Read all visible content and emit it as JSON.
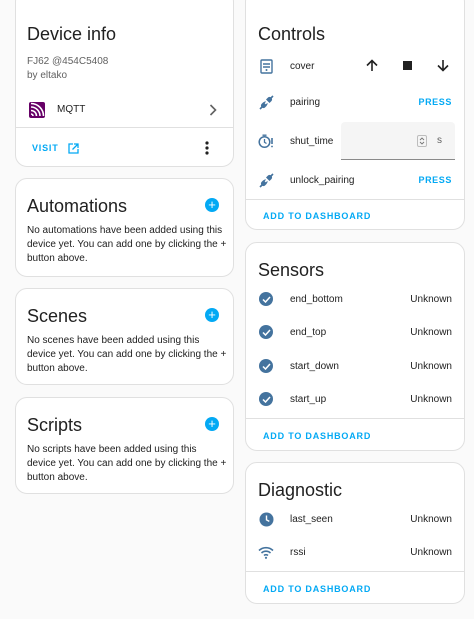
{
  "device_info": {
    "title": "Device info",
    "model": "FJ62 @454C5408",
    "manufacturer": "by eltako",
    "integration": "MQTT",
    "visit_label": "VISIT"
  },
  "automations": {
    "title": "Automations",
    "description": "No automations have been added using this device yet. You can add one by clicking the + button above."
  },
  "scenes": {
    "title": "Scenes",
    "description": "No scenes have been added using this device yet. You can add one by clicking the + button above."
  },
  "scripts": {
    "title": "Scripts",
    "description": "No scripts have been added using this device yet. You can add one by clicking the + button above."
  },
  "controls": {
    "title": "Controls",
    "entities": [
      {
        "name": "cover"
      },
      {
        "name": "pairing",
        "action": "PRESS"
      },
      {
        "name": "shut_time",
        "unit": "s",
        "value": ""
      },
      {
        "name": "unlock_pairing",
        "action": "PRESS"
      }
    ],
    "add_label": "ADD TO DASHBOARD"
  },
  "sensors": {
    "title": "Sensors",
    "entities": [
      {
        "name": "end_bottom",
        "state": "Unknown"
      },
      {
        "name": "end_top",
        "state": "Unknown"
      },
      {
        "name": "start_down",
        "state": "Unknown"
      },
      {
        "name": "start_up",
        "state": "Unknown"
      }
    ],
    "add_label": "ADD TO DASHBOARD"
  },
  "diagnostic": {
    "title": "Diagnostic",
    "entities": [
      {
        "name": "last_seen",
        "state": "Unknown"
      },
      {
        "name": "rssi",
        "state": "Unknown"
      }
    ],
    "add_label": "ADD TO DASHBOARD"
  },
  "colors": {
    "accent": "#03a9f4",
    "icon": "#44739e",
    "mqtt": "#660066"
  }
}
